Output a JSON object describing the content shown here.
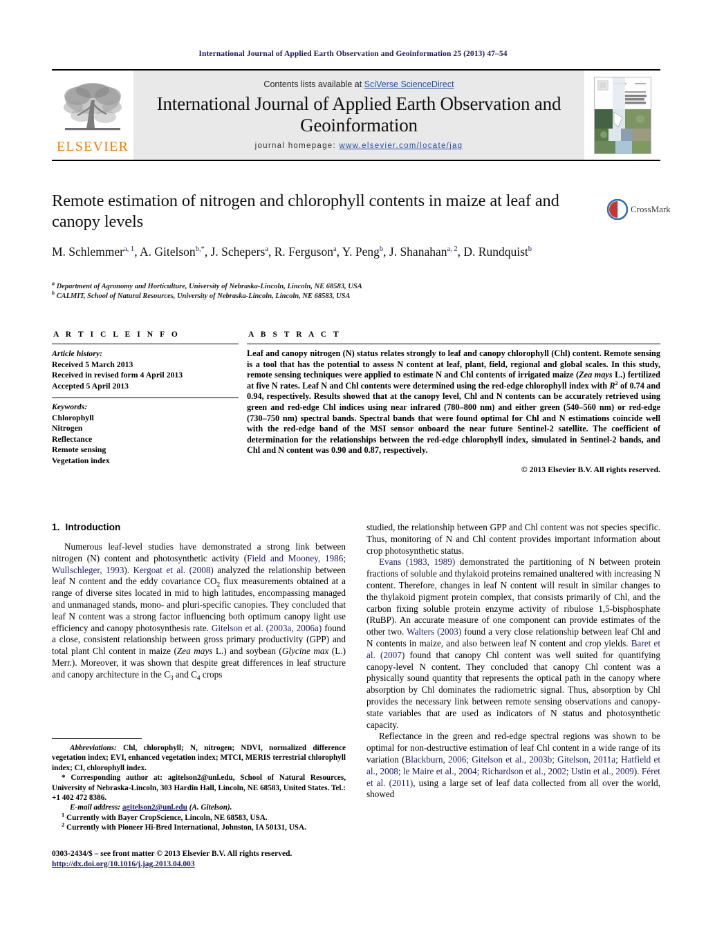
{
  "running_head": "International Journal of Applied Earth Observation and Geoinformation 25 (2013) 47–54",
  "banner": {
    "publisher_name": "ELSEVIER",
    "publisher_logo_icon": "elsevier-tree-icon",
    "contents_prefix": "Contents lists available at ",
    "contents_link": "SciVerse ScienceDirect",
    "journal_title": "International Journal of Applied Earth Observation and Geoinformation",
    "homepage_prefix": "journal homepage: ",
    "homepage_url": "www.elsevier.com/locate/jag",
    "cover_icon": "journal-cover-thumbnail"
  },
  "article": {
    "title": "Remote estimation of nitrogen and chlorophyll contents in maize at leaf and canopy levels",
    "crossmark_label": "CrossMark",
    "crossmark_icon": "crossmark-shield-icon",
    "authors": [
      {
        "name": "M. Schlemmer",
        "marks": "a, 1",
        "sep": ", "
      },
      {
        "name": "A. Gitelson",
        "marks": "b,",
        "star": "*",
        "sep": ", "
      },
      {
        "name": "J. Schepers",
        "marks": "a",
        "sep": ", "
      },
      {
        "name": "R. Ferguson",
        "marks": "a",
        "sep": ", "
      },
      {
        "name": "Y. Peng",
        "marks": "b",
        "sep": ", "
      },
      {
        "name": "J. Shanahan",
        "marks": "a, 2",
        "sep": ", "
      },
      {
        "name": "D. Rundquist",
        "marks": "b",
        "sep": ""
      }
    ],
    "affiliations": [
      {
        "mark": "a",
        "text": "Department of Agronomy and Horticulture, University of Nebraska-Lincoln, Lincoln, NE 68583, USA"
      },
      {
        "mark": "b",
        "text": "CALMIT, School of Natural Resources, University of Nebraska-Lincoln, Lincoln, NE 68583, USA"
      }
    ]
  },
  "article_info": {
    "heading": "A R T I C L E   I N F O",
    "history_label": "Article history:",
    "history": [
      "Received 5 March 2013",
      "Received in revised form 4 April 2013",
      "Accepted 5 April 2013"
    ],
    "keywords_label": "Keywords:",
    "keywords": [
      "Chlorophyll",
      "Nitrogen",
      "Reflectance",
      "Remote sensing",
      "Vegetation index"
    ]
  },
  "abstract": {
    "heading": "A B S T R A C T",
    "text_part1": "Leaf and canopy nitrogen (N) status relates strongly to leaf and canopy chlorophyll (Chl) content. Remote sensing is a tool that has the potential to assess N content at leaf, plant, field, regional and global scales. In this study, remote sensing techniques were applied to estimate N and Chl contents of irrigated maize (",
    "italic1": "Zea mays",
    "text_part2": " L.) fertilized at five N rates. Leaf N and Chl contents were determined using the red-edge chlorophyll index with ",
    "italic2": "R",
    "sup2": "2",
    "text_part3": " of 0.74 and 0.94, respectively. Results showed that at the canopy level, Chl and N contents can be accurately retrieved using green and red-edge Chl indices using near infrared (780–800 nm) and either green (540–560 nm) or red-edge (730–750 nm) spectral bands. Spectral bands that were found optimal for Chl and N estimations coincide well with the red-edge band of the MSI sensor onboard the near future Sentinel-2 satellite. The coefficient of determination for the relationships between the red-edge chlorophyll index, simulated in Sentinel-2 bands, and Chl and N content was 0.90 and 0.87, respectively.",
    "copyright": "© 2013 Elsevier B.V. All rights reserved."
  },
  "introduction": {
    "section_number": "1.",
    "section_title": "Introduction",
    "left_p1_a": "Numerous leaf-level studies have demonstrated a strong link between nitrogen (N) content and photosynthetic activity (",
    "left_cite1": "Field and Mooney, 1986; Wullschleger, 1993",
    "left_p1_b": "). ",
    "left_cite2": "Kergoat et al. (2008)",
    "left_p1_c": " analyzed the relationship between leaf N content and the eddy covariance CO",
    "left_sub1": "2",
    "left_p1_d": " flux measurements obtained at a range of diverse sites located in mid to high latitudes, encompassing managed and unmanaged stands, mono- and pluri-specific canopies. They concluded that leaf N content was a strong factor influencing both optimum canopy light use efficiency and canopy photosynthesis rate. ",
    "left_cite3": "Gitelson et al. (2003a, 2006a)",
    "left_p1_e": " found a close, consistent relationship between gross primary productivity (GPP) and total plant Chl content in maize (",
    "left_ital1": "Zea mays",
    "left_p1_f": " L.) and soybean (",
    "left_ital2": "Glycine max",
    "left_p1_g": " (L.) Merr.). Moreover, it was shown that despite great differences in leaf structure and canopy architecture in the C",
    "left_sub2": "3",
    "left_p1_h": " and C",
    "left_sub3": "4",
    "left_p1_i": " crops",
    "right_p1": "studied, the relationship between GPP and Chl content was not species specific. Thus, monitoring of N and Chl content provides important information about crop photosynthetic status.",
    "right_cite1": "Evans (1983, 1989)",
    "right_p2_a": " demonstrated the partitioning of N between protein fractions of soluble and thylakoid proteins remained unaltered with increasing N content. Therefore, changes in leaf N content will result in similar changes to the thylakoid pigment protein complex, that consists primarily of Chl, and the carbon fixing soluble protein enzyme activity of ribulose 1,5-bisphosphate (RuBP). An accurate measure of one component can provide estimates of the other two. ",
    "right_cite2": "Walters (2003)",
    "right_p2_b": " found a very close relationship between leaf Chl and N contents in maize, and also between leaf N content and crop yields. ",
    "right_cite3": "Baret et al. (2007)",
    "right_p2_c": " found that canopy Chl content was well suited for quantifying canopy-level N content. They concluded that canopy Chl content was a physically sound quantity that represents the optical path in the canopy where absorption by Chl dominates the radiometric signal. Thus, absorption by Chl provides the necessary link between remote sensing observations and canopy-state variables that are used as indicators of N status and photosynthetic capacity.",
    "right_p3_a": "Reflectance in the green and red-edge spectral regions was shown to be optimal for non-destructive estimation of leaf Chl content in a wide range of its variation (",
    "right_cite4": "Blackburn, 2006; Gitelson et al., 2003b; Gitelson, 2011a; Hatfield et al., 2008; le Maire et al., 2004; Richardson et al., 2002; Ustin et al., 2009",
    "right_p3_b": "). ",
    "right_cite5": "Féret et al. (2011)",
    "right_p3_c": ", using a large set of leaf data collected from all over the world, showed"
  },
  "footnotes": {
    "abbrev_label": "Abbreviations:",
    "abbrev_text": " Chl, chlorophyll; N, nitrogen; NDVI, normalized difference vegetation index; EVI, enhanced vegetation index; MTCI, MERIS terrestrial chlorophyll index; CI, chlorophyll index.",
    "corresponding_star": "*",
    "corresponding_text": " Corresponding author at: agitelson2@unl.edu, School of Natural Resources, University of Nebraska-Lincoln, 303 Hardin Hall, Lincoln, NE 68583, United States. Tel.: +1 402 472 8386.",
    "email_label": "E-mail address:",
    "email_link": "agitelson2@unl.edu",
    "email_suffix": " (A. Gitelson).",
    "note1_mark": "1",
    "note1_text": " Currently with Bayer CropScience, Lincoln, NE 68583, USA.",
    "note2_mark": "2",
    "note2_text": " Currently with Pioneer Hi-Bred International, Johnston, IA 50131, USA."
  },
  "imprint": {
    "line1": "0303-2434/$ – see front matter © 2013 Elsevier B.V. All rights reserved.",
    "doi": "http://dx.doi.org/10.1016/j.jag.2013.04.003"
  },
  "colors": {
    "elsevier_orange": "#f07c00",
    "link_blue": "#1f4fa5",
    "cite_navy": "#1a1a6e",
    "banner_gray": "#e9e9ea"
  }
}
